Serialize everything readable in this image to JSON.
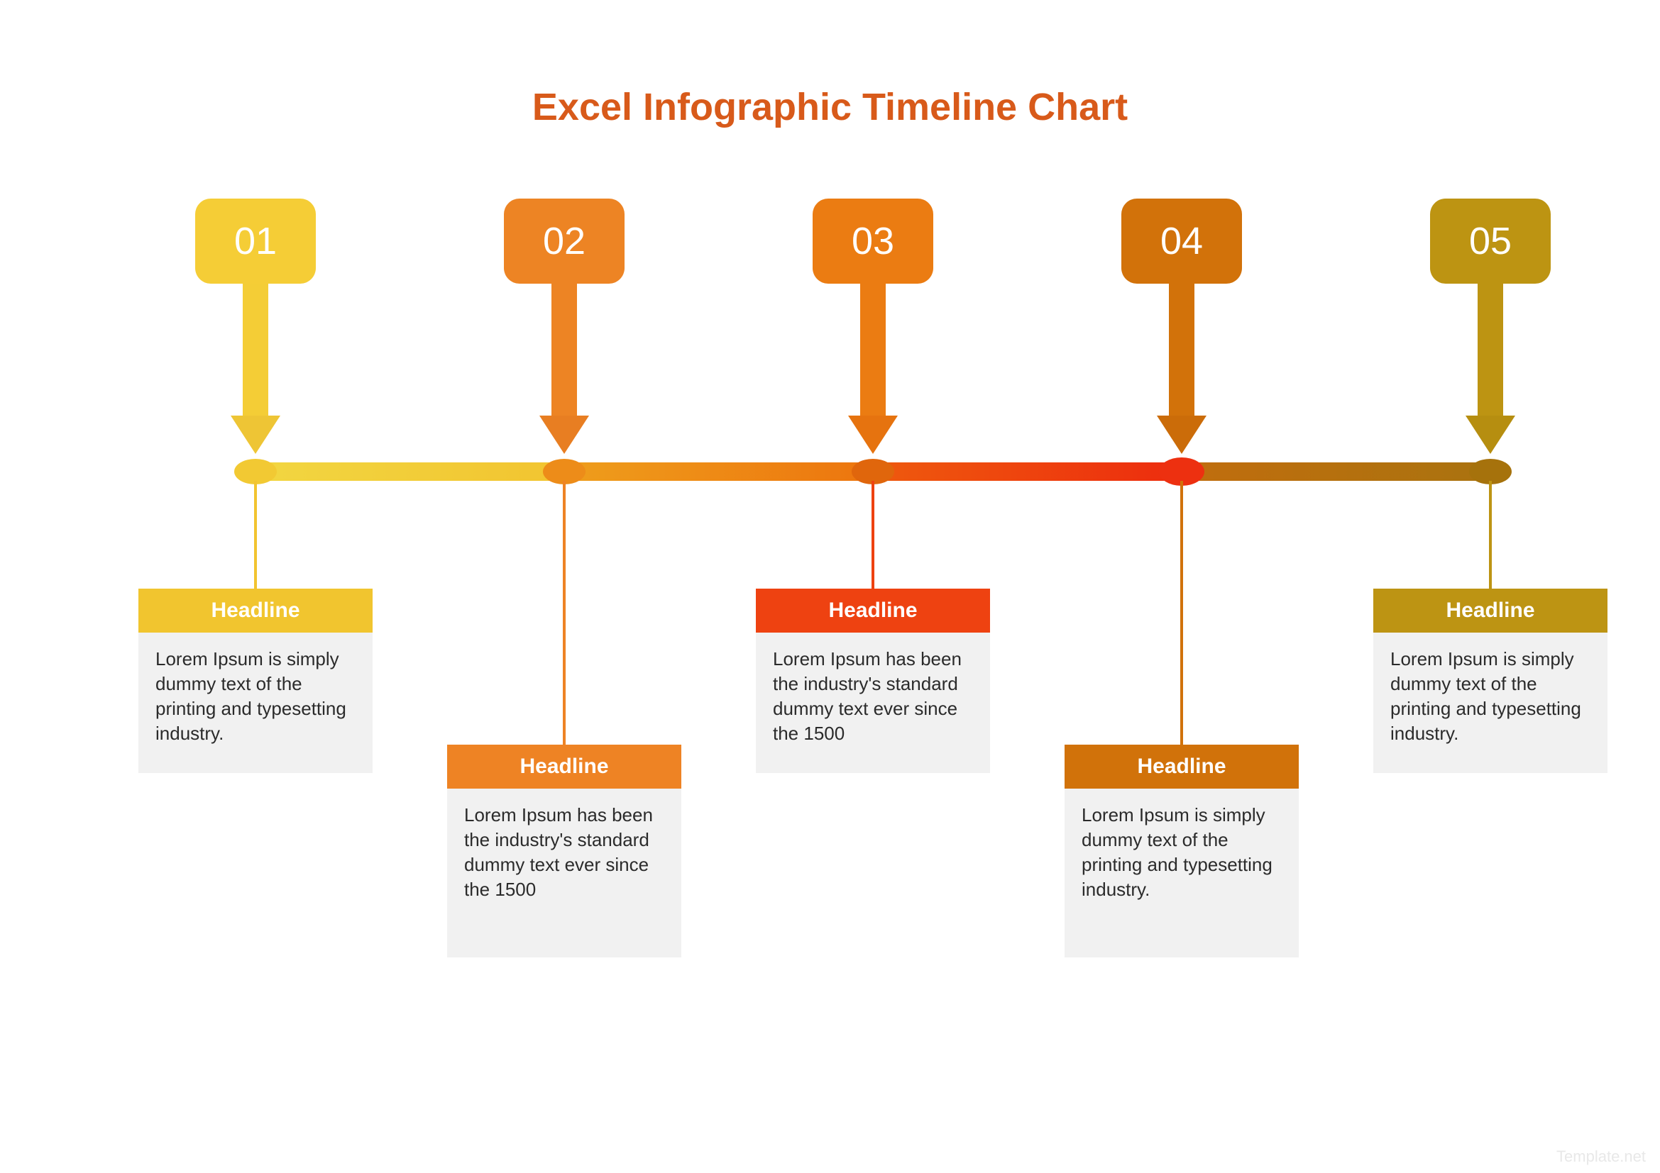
{
  "title": "Excel Infographic Timeline Chart",
  "watermark": "Template.net",
  "items": [
    {
      "num": "01",
      "headline": "Headline",
      "body": "Lorem Ipsum is simply dummy text of the printing and typesetting industry.",
      "box_color": "#f5cd36",
      "arrow_shaft": "#f4cd36",
      "arrow_head": "#eec535",
      "node_color": "#f2c933",
      "segment_to_next": [
        "#f2d742",
        "#f2c430"
      ],
      "connector_color": "#f2c430",
      "header_color": "#f1c52f",
      "card_row": "top"
    },
    {
      "num": "02",
      "headline": "Headline",
      "body": "Lorem Ipsum has been the industry's standard dummy text ever since the 1500",
      "box_color": "#ed8424",
      "arrow_shaft": "#ed8424",
      "arrow_head": "#e87e22",
      "node_color": "#ed8c19",
      "segment_to_next": [
        "#ee9e1c",
        "#ed750e"
      ],
      "connector_color": "#ee8324",
      "header_color": "#ee8324",
      "card_row": "bottom"
    },
    {
      "num": "03",
      "headline": "Headline",
      "body": "Lorem Ipsum has been the industry's standard dummy text ever since the 1500",
      "box_color": "#eb7c12",
      "arrow_shaft": "#eb7c12",
      "arrow_head": "#e6730f",
      "node_color": "#e0660c",
      "segment_to_next": [
        "#ee5a0e",
        "#ed2c0e"
      ],
      "connector_color": "#ee4210",
      "header_color": "#ee4211",
      "card_row": "top"
    },
    {
      "num": "04",
      "headline": "Headline",
      "body": "Lorem Ipsum is simply dummy text of the printing and typesetting industry.",
      "box_color": "#d2720a",
      "arrow_shaft": "#d2720a",
      "arrow_head": "#cb6c09",
      "node_color": "#ed3010",
      "segment_to_next": [
        "#c16d0e",
        "#a9730f"
      ],
      "connector_color": "#d1720a",
      "header_color": "#d1720a",
      "card_row": "bottom"
    },
    {
      "num": "05",
      "headline": "Headline",
      "body": "Lorem Ipsum is simply dummy text of the printing and typesetting industry.",
      "box_color": "#bd9412",
      "arrow_shaft": "#bd9412",
      "arrow_head": "#b68e10",
      "node_color": "#a6720c",
      "segment_to_next": null,
      "connector_color": "#bd9413",
      "header_color": "#bd9413",
      "card_row": "top"
    }
  ]
}
